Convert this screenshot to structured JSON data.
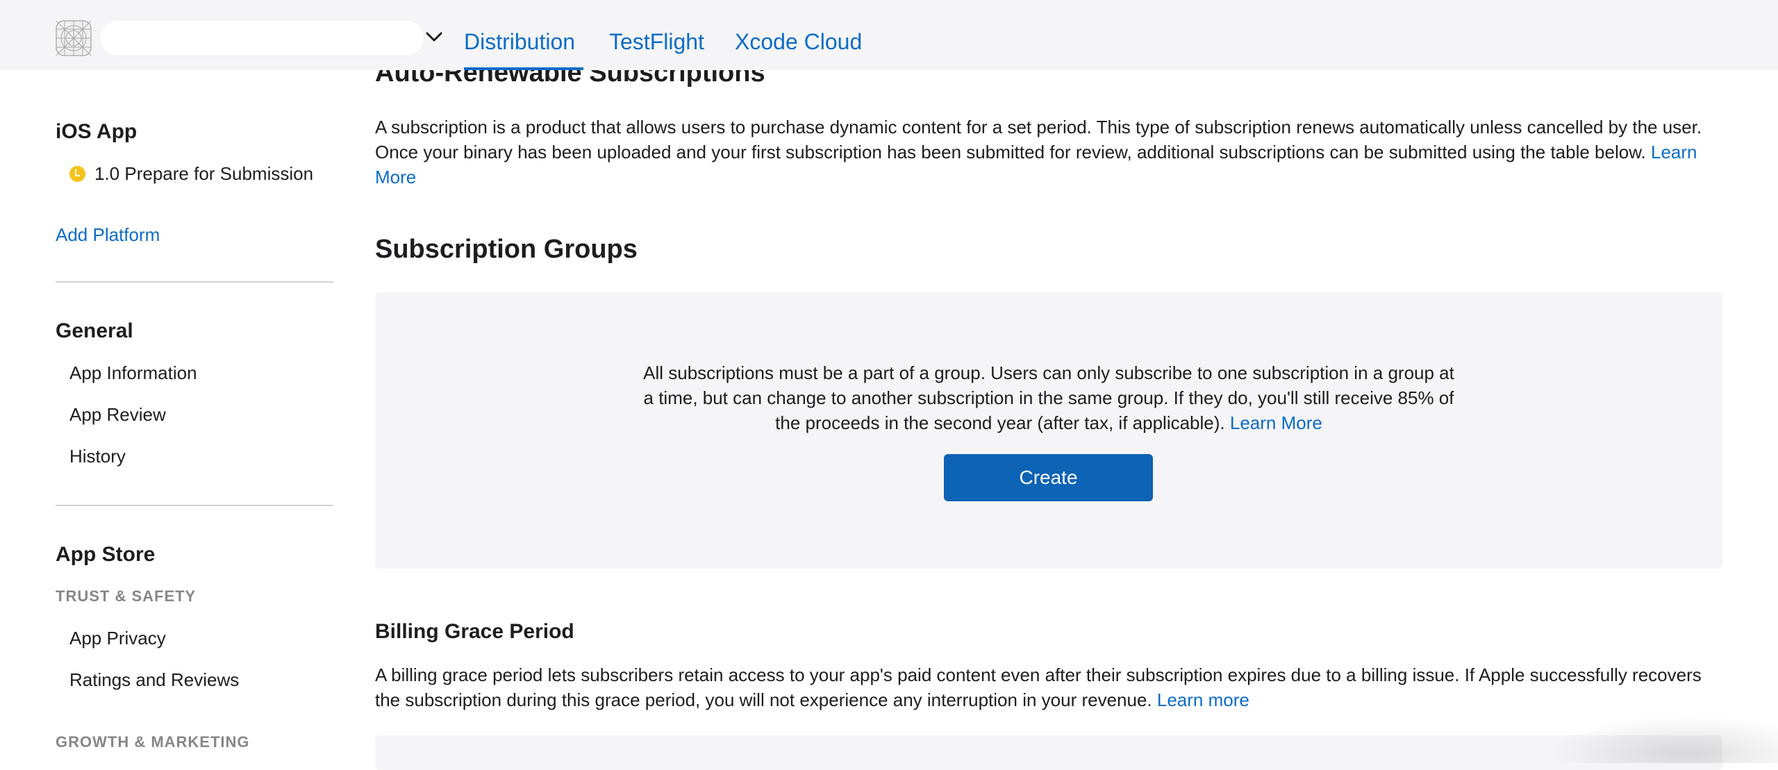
{
  "header": {
    "account_name": "",
    "tabs": [
      {
        "label": "Distribution",
        "active": true
      },
      {
        "label": "TestFlight",
        "active": false
      },
      {
        "label": "Xcode Cloud",
        "active": false
      }
    ],
    "icons": {
      "logo": "app-icon-grid",
      "account_menu": "chevron-down-icon"
    },
    "accent_color": "#0b6cc7"
  },
  "sidebar": {
    "platform_heading": "iOS App",
    "version": {
      "label": "1.0 Prepare for Submission",
      "status_color": "#f5c21b"
    },
    "add_platform": "Add Platform",
    "general_heading": "General",
    "general_items": [
      "App Information",
      "App Review",
      "History"
    ],
    "app_store_heading": "App Store",
    "trust_safety": "TRUST & SAFETY",
    "trust_items": [
      "App Privacy",
      "Ratings and Reviews"
    ],
    "growth_marketing": "GROWTH & MARKETING"
  },
  "main": {
    "title": "Auto-Renewable Subscriptions",
    "intro": "A subscription is a product that allows users to purchase dynamic content for a set period. This type of subscription renews automatically unless cancelled by the user. Once your binary has been uploaded and your first subscription has been submitted for review, additional subscriptions can be submitted using the table below.",
    "intro_link": "Learn More",
    "groups_title": "Subscription Groups",
    "groups_text": "All subscriptions must be a part of a group. Users can only subscribe to one subscription in a group at a time, but can change to another subscription in the same group. If they do, you'll still receive 85% of the proceeds in the second year (after tax, if applicable).",
    "groups_link": "Learn More",
    "create_button": "Create",
    "billing_title": "Billing Grace Period",
    "billing_text": "A billing grace period lets subscribers retain access to your app's paid content even after their subscription expires due to a billing issue. If Apple successfully recovers the subscription during this grace period, you will not experience any interruption in your revenue.",
    "billing_link": "Learn more"
  }
}
